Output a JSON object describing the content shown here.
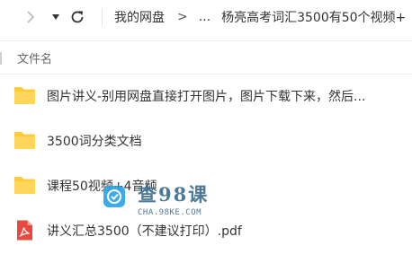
{
  "toolbar": {
    "back_icon": "chevron-right-icon",
    "dropdown_icon": "caret-down-icon",
    "refresh_icon": "refresh-icon"
  },
  "breadcrumb": {
    "root": "我的网盘",
    "separator": ">",
    "ellipsis": "...",
    "current": "杨亮高考词汇3500有50个视频+"
  },
  "list_header": {
    "column_name": "文件名"
  },
  "files": [
    {
      "name": "图片讲义-别用网盘直接打开图片，图片下载下来，然后...",
      "type": "folder"
    },
    {
      "name": "3500词分类文档",
      "type": "folder"
    },
    {
      "name": "课程50视频+4音频",
      "type": "folder"
    },
    {
      "name": "讲义汇总3500（不建议打印）.pdf",
      "type": "pdf"
    }
  ],
  "watermark": {
    "title": "查98课",
    "url": "CHA.98KE.COM"
  },
  "colors": {
    "folder": "#ffcb3d",
    "pdf": "#e8483f",
    "watermark": "#27a2e6"
  }
}
